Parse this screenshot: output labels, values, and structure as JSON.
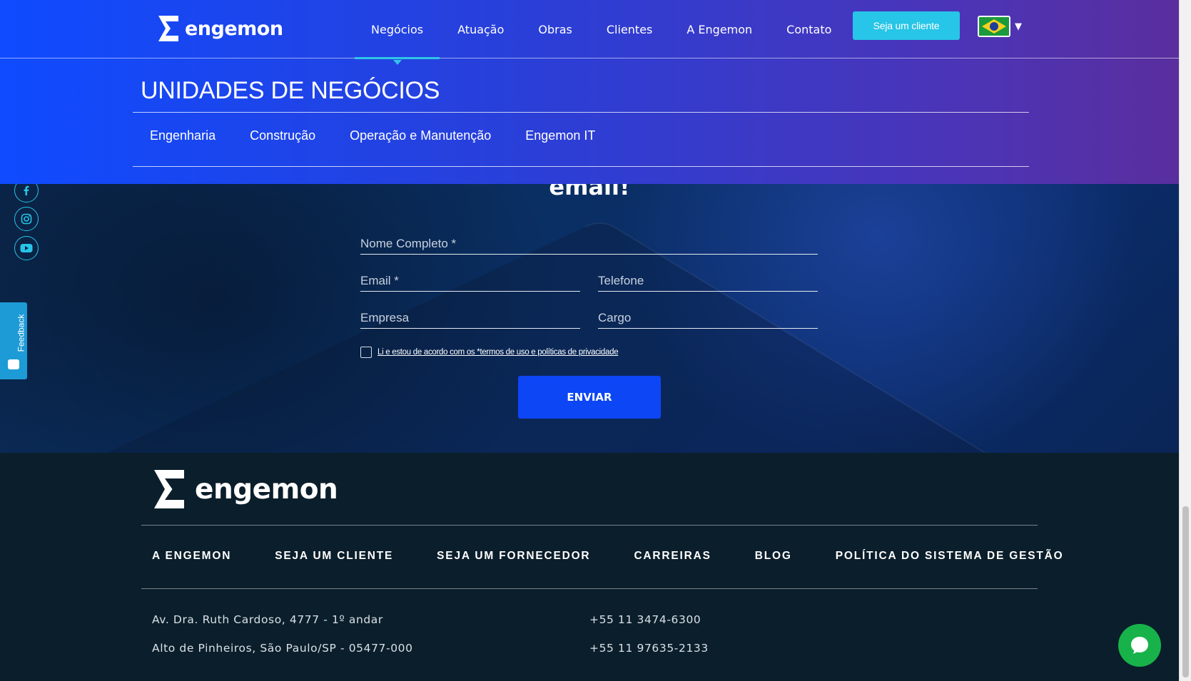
{
  "brand": {
    "name": "engemon"
  },
  "nav": {
    "items": [
      {
        "label": "Negócios",
        "active": true
      },
      {
        "label": "Atuação",
        "active": false
      },
      {
        "label": "Obras",
        "active": false
      },
      {
        "label": "Clientes",
        "active": false
      },
      {
        "label": "A Engemon",
        "active": false
      },
      {
        "label": "Contato",
        "active": false
      }
    ],
    "cta_label": "Seja um cliente",
    "language_icon": "brazil-flag-icon"
  },
  "business_units": {
    "title": "UNIDADES DE NEGÓCIOS",
    "items": [
      "Engenharia",
      "Construção",
      "Operação e Manutenção",
      "Engemon IT"
    ]
  },
  "social": [
    "facebook-icon",
    "instagram-icon",
    "youtube-icon"
  ],
  "feedback": {
    "label": "Feedback"
  },
  "form": {
    "heading_visible_fragment": "email!",
    "fields": {
      "name": "Nome Completo *",
      "email": "Email *",
      "phone": "Telefone",
      "company": "Empresa",
      "role": "Cargo"
    },
    "consent_text": "Li e estou de acordo com os *termos de uso e políticas de privacidade",
    "submit_label": "ENVIAR"
  },
  "footer": {
    "nav": [
      "A ENGEMON",
      "SEJA UM CLIENTE",
      "SEJA UM FORNECEDOR",
      "CARREIRAS",
      "BLOG",
      "POLÍTICA DO SISTEMA DE GESTÃO"
    ],
    "address_line1": "Av. Dra. Ruth Cardoso, 4777 - 1º andar",
    "address_line2": "Alto de Pinheiros, São Paulo/SP - 05477-000",
    "phone1": "+55 11 3474-6300",
    "phone2": "+55 11 97635-2133"
  },
  "colors": {
    "accent_cyan": "#27c5e7",
    "primary_blue": "#0d46f5",
    "footer_bg": "#0b1e2b",
    "chat_green": "#17b34a"
  }
}
